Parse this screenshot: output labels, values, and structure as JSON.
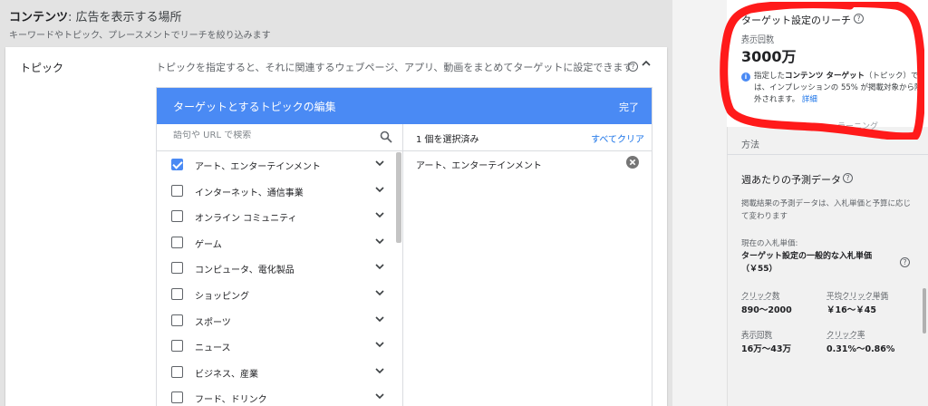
{
  "header": {
    "title_bold": "コンテンツ",
    "title_rest": ": 広告を表示する場所",
    "subtitle": "キーワードやトピック、プレースメントでリーチを絞り込みます"
  },
  "topic_section": {
    "label": "トピック",
    "description": "トピックを指定すると、それに関連するウェブページ、アプリ、動画をまとめてターゲットに設定できます",
    "help_icon": "?",
    "collapse_icon": "^"
  },
  "editor": {
    "title": "ターゲットとするトピックの編集",
    "done_label": "完了",
    "search_placeholder": "語句や URL で検索",
    "selected_count": "1 個を選択済み",
    "clear_all_label": "すべてクリア",
    "selected_items": [
      "アート、エンターテインメント"
    ]
  },
  "topics": [
    {
      "label": "アート、エンターテインメント",
      "checked": true
    },
    {
      "label": "インターネット、通信事業",
      "checked": false
    },
    {
      "label": "オンライン コミュニティ",
      "checked": false
    },
    {
      "label": "ゲーム",
      "checked": false
    },
    {
      "label": "コンピュータ、電化製品",
      "checked": false
    },
    {
      "label": "ショッピング",
      "checked": false
    },
    {
      "label": "スポーツ",
      "checked": false
    },
    {
      "label": "ニュース",
      "checked": false
    },
    {
      "label": "ビジネス、産業",
      "checked": false
    },
    {
      "label": "フード、ドリンク",
      "checked": false
    }
  ],
  "sidebar": {
    "reach_title": "ターゲット設定のリーチ",
    "impressions_label": "表示回数",
    "impressions_value": "3000万",
    "info_icon": "i",
    "note_pre": "指定した",
    "note_bold": "コンテンツ ターゲット",
    "note_post": "（トピック）では、インプレッションの 55% が掲載対象から除外されます。",
    "note_link": "詳細",
    "partial_text": "ラーニング",
    "method": "方法",
    "forecast_title": "週あたりの予測データ",
    "forecast_desc": "掲載結果の予測データは、入札単価と予算に応じて変わります",
    "bid_label": "現在の入札単価:",
    "bid_value": "ターゲット設定の一般的な入札単価（￥55）",
    "metrics": [
      {
        "label": "クリック数",
        "value": "890〜2000"
      },
      {
        "label": "平均クリック単価",
        "value": "￥16〜￥45"
      },
      {
        "label": "表示回数",
        "value": "16万〜43万"
      },
      {
        "label": "クリック率",
        "value": "0.31%〜0.86%"
      }
    ]
  },
  "colors": {
    "accent_blue": "#4a8af4",
    "link_blue": "#1a73e8",
    "annotation_red": "#ff1a1a"
  }
}
